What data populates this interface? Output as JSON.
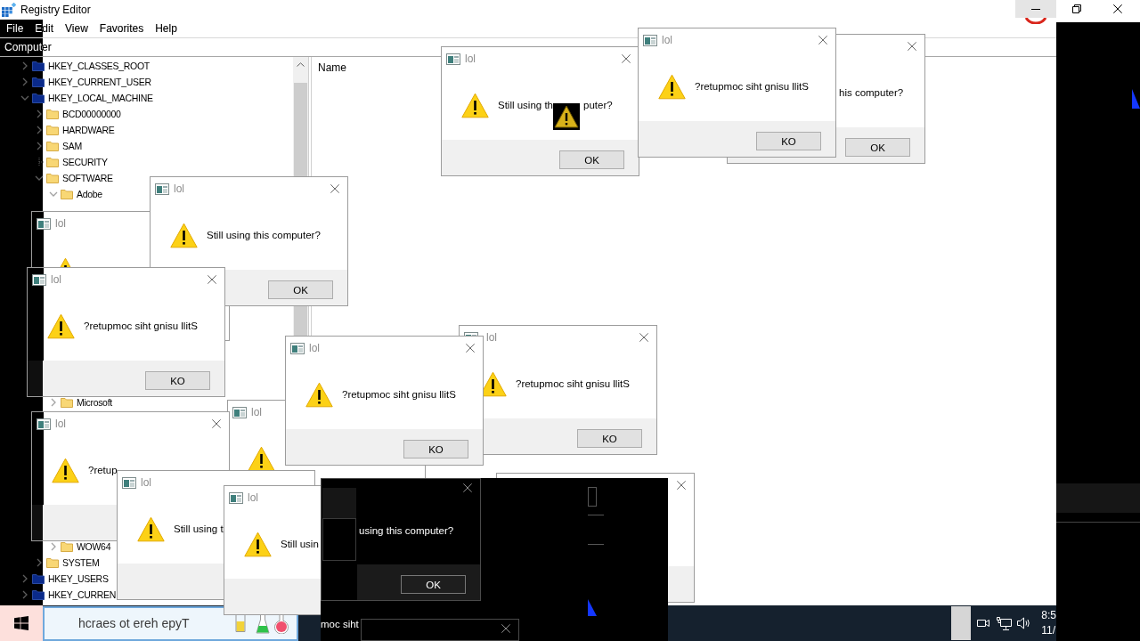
{
  "registry_editor": {
    "title": "Registry Editor",
    "menu": [
      "File",
      "Edit",
      "View",
      "Favorites",
      "Help"
    ],
    "address": "Computer",
    "tree": [
      {
        "label": "HKEY_CLASSES_ROOT",
        "expandable": true,
        "expanded": false
      },
      {
        "label": "HKEY_CURRENT_USER",
        "expandable": true,
        "expanded": false
      },
      {
        "label": "HKEY_LOCAL_MACHINE",
        "expandable": true,
        "expanded": true,
        "children": [
          {
            "label": "BCD00000000",
            "expandable": true,
            "expanded": false
          },
          {
            "label": "HARDWARE",
            "expandable": true,
            "expanded": false
          },
          {
            "label": "SAM",
            "expandable": true,
            "expanded": false
          },
          {
            "label": "SECURITY",
            "expandable": false
          },
          {
            "label": "SOFTWARE",
            "expandable": true,
            "expanded": true,
            "children": [
              {
                "label": "Adobe",
                "expandable": true,
                "expanded": true
              },
              {
                "label": "Microsoft",
                "expandable": true,
                "expanded": false
              },
              {
                "label": "WOW64",
                "expandable": true,
                "expanded": false
              }
            ]
          },
          {
            "label": "SYSTEM",
            "expandable": true,
            "expanded": false
          }
        ]
      },
      {
        "label": "HKEY_USERS",
        "expandable": true,
        "expanded": false
      },
      {
        "label": "HKEY_CURREN",
        "expandable": true,
        "expanded": false
      }
    ],
    "columns": [
      "Name"
    ]
  },
  "dialogs": [
    {
      "kind": "light",
      "message": "his computer?",
      "button": "OK"
    },
    {
      "kind": "light",
      "title": "lol",
      "message_parts": [
        "Still using th",
        "puter?"
      ],
      "button": "OK"
    },
    {
      "kind": "light",
      "title": "lol",
      "message": "?retupmoc siht gnisu llitS",
      "button": "KO"
    },
    {
      "kind": "light",
      "title": "lol"
    },
    {
      "kind": "light",
      "title": "lol",
      "message": "Still using this computer?",
      "button": "OK"
    },
    {
      "kind": "light",
      "title": "lol",
      "message": "?retupmoc siht gnisu llitS",
      "button": "KO"
    },
    {
      "kind": "light",
      "title": "lol"
    },
    {
      "kind": "light",
      "title": "lol",
      "message": "?retupmoc siht gnisu llitS",
      "button": "KO"
    },
    {
      "kind": "light",
      "title": "lol",
      "message": "?retupmoc siht gnisu llitS",
      "button": "KO"
    },
    {
      "kind": "light",
      "title": "lol",
      "message": "?retup"
    },
    {
      "kind": "light"
    },
    {
      "kind": "light",
      "title": "lol",
      "message": "Still using t"
    },
    {
      "kind": "light",
      "title": "lol",
      "message": "Still usin"
    },
    {
      "kind": "dark",
      "message": "using this computer?",
      "button": "OK"
    },
    {
      "kind": "dark"
    }
  ],
  "screen_artifact": {
    "text": "moc siht"
  },
  "taskbar": {
    "search": {
      "placeholder": "hcraes ot ereh epyT"
    },
    "clock": {
      "time": "8:5",
      "date": "11/"
    }
  }
}
